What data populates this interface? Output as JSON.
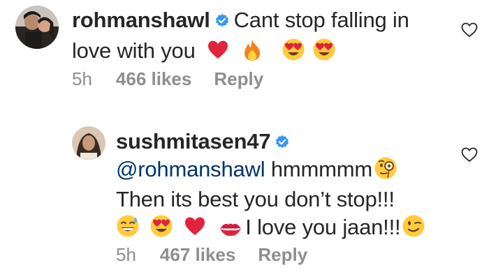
{
  "comments": [
    {
      "username": "rohmanshawl",
      "line1": "Cant stop falling in",
      "line2": "love with you",
      "time": "5h",
      "likes": "466 likes",
      "reply": "Reply",
      "icons": [
        "verified-badge-icon",
        "red-heart-emoji",
        "fire-emoji",
        "heart-eyes-emoji",
        "heart-eyes-emoji"
      ]
    },
    {
      "username": "sushmitasen47",
      "mention": "@rohmanshawl",
      "line1": "hmmmmm",
      "line2": "Then its best you don’t stop!!!",
      "line3": "I love you jaan!!!",
      "time": "5h",
      "likes": "467 likes",
      "reply": "Reply",
      "icons": [
        "verified-badge-icon",
        "monocle-face-emoji",
        "sweat-smile-emoji",
        "heart-eyes-emoji",
        "red-heart-emoji",
        "kiss-mark-emoji",
        "winking-face-emoji"
      ]
    }
  ],
  "colors": {
    "verified": "#3897f0",
    "meta": "#8e8e8e",
    "mention": "#003569"
  }
}
